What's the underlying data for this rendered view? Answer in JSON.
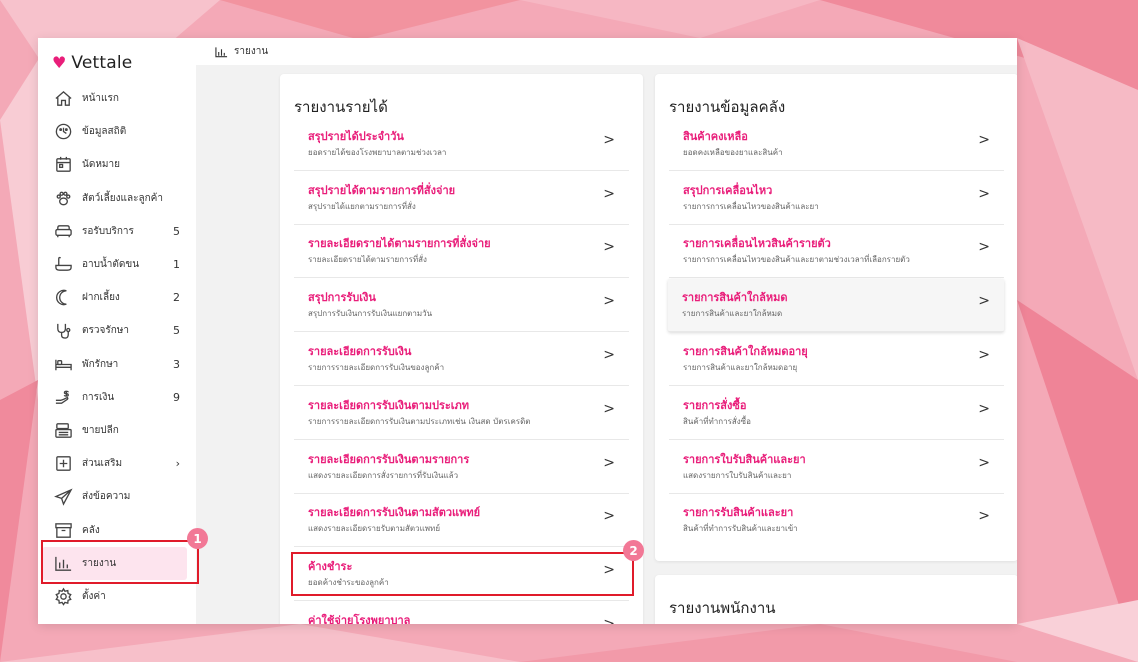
{
  "app": {
    "brand": "Vettale"
  },
  "breadcrumb": {
    "label": "รายงาน"
  },
  "sidebar": {
    "items": [
      {
        "label": "หน้าแรก",
        "icon": "home-icon",
        "count": ""
      },
      {
        "label": "ข้อมูลสถิติ",
        "icon": "stats-icon",
        "count": ""
      },
      {
        "label": "นัดหมาย",
        "icon": "calendar-icon",
        "count": ""
      },
      {
        "label": "สัตว์เลี้ยงและลูกค้า",
        "icon": "paw-icon",
        "count": ""
      },
      {
        "label": "รอรับบริการ",
        "icon": "sofa-icon",
        "count": "5"
      },
      {
        "label": "อาบน้ำตัดขน",
        "icon": "bathtub-icon",
        "count": "1"
      },
      {
        "label": "ฝากเลี้ยง",
        "icon": "moon-icon",
        "count": "2"
      },
      {
        "label": "ตรวจรักษา",
        "icon": "stethoscope-icon",
        "count": "5"
      },
      {
        "label": "พักรักษา",
        "icon": "bed-icon",
        "count": "3"
      },
      {
        "label": "การเงิน",
        "icon": "money-icon",
        "count": "9"
      },
      {
        "label": "ขายปลีก",
        "icon": "cash-register-icon",
        "count": ""
      },
      {
        "label": "ส่วนเสริม",
        "icon": "plus-box-icon",
        "count": "›"
      },
      {
        "label": "ส่งข้อความ",
        "icon": "send-icon",
        "count": ""
      },
      {
        "label": "คลัง",
        "icon": "archive-icon",
        "count": ""
      },
      {
        "label": "รายงาน",
        "icon": "bar-chart-icon",
        "count": "",
        "active": true
      },
      {
        "label": "ตั้งค่า",
        "icon": "gear-icon",
        "count": ""
      }
    ]
  },
  "annotations": {
    "badge1": "1",
    "badge2": "2"
  },
  "income_card": {
    "title": "รายงานรายได้",
    "rows": [
      {
        "title": "สรุปรายได้ประจำวัน",
        "sub": "ยอดรายได้ของโรงพยาบาลตามช่วงเวลา"
      },
      {
        "title": "สรุปรายได้ตามรายการที่สั่งจ่าย",
        "sub": "สรุปรายได้แยกตามรายการที่สั่ง"
      },
      {
        "title": "รายละเอียดรายได้ตามรายการที่สั่งจ่าย",
        "sub": "รายละเอียดรายได้ตามรายการที่สั่ง"
      },
      {
        "title": "สรุปการรับเงิน",
        "sub": "สรุปการรับเงินการรับเงินแยกตามวัน"
      },
      {
        "title": "รายละเอียดการรับเงิน",
        "sub": "รายการรายละเอียดการรับเงินของลูกค้า"
      },
      {
        "title": "รายละเอียดการรับเงินตามประเภท",
        "sub": "รายการรายละเอียดการรับเงินตามประเภทเช่น เงินสด บัตรเครดิต"
      },
      {
        "title": "รายละเอียดการรับเงินตามรายการ",
        "sub": "แสดงรายละเอียดการสั่งรายการที่รับเงินแล้ว"
      },
      {
        "title": "รายละเอียดการรับเงินตามสัตวแพทย์",
        "sub": "แสดงรายละเอียดรายรับตามสัตวแพทย์"
      },
      {
        "title": "ค้างชำระ",
        "sub": "ยอดค้างชำระของลูกค้า"
      },
      {
        "title": "ค่าใช้จ่ายโรงพยาบาล",
        "sub": ""
      }
    ]
  },
  "stock_card": {
    "title": "รายงานข้อมูลคลัง",
    "rows": [
      {
        "title": "สินค้าคงเหลือ",
        "sub": "ยอดคงเหลือของยาและสินค้า"
      },
      {
        "title": "สรุปการเคลื่อนไหว",
        "sub": "รายการการเคลื่อนไหวของสินค้าและยา"
      },
      {
        "title": "รายการเคลื่อนไหวสินค้ารายตัว",
        "sub": "รายการการเคลื่อนไหวของสินค้าและยาตามช่วงเวลาที่เลือกรายตัว"
      },
      {
        "title": "รายการสินค้าใกล้หมด",
        "sub": "รายการสินค้าและยาใกล้หมด"
      },
      {
        "title": "รายการสินค้าใกล้หมดอายุ",
        "sub": "รายการสินค้าและยาใกล้หมดอายุ"
      },
      {
        "title": "รายการสั่งซื้อ",
        "sub": "สินค้าที่ทำการสั่งซื้อ"
      },
      {
        "title": "รายการใบรับสินค้าและยา",
        "sub": "แสดงรายการใบรับสินค้าและยา"
      },
      {
        "title": "รายการรับสินค้าและยา",
        "sub": "สินค้าที่ทำการรับสินค้าและยาเข้า"
      }
    ]
  },
  "staff_card": {
    "title": "รายงานพนักงาน"
  },
  "colors": {
    "accent": "#e91e7a",
    "highlight": "#e01b2a",
    "badge": "#f27896"
  }
}
